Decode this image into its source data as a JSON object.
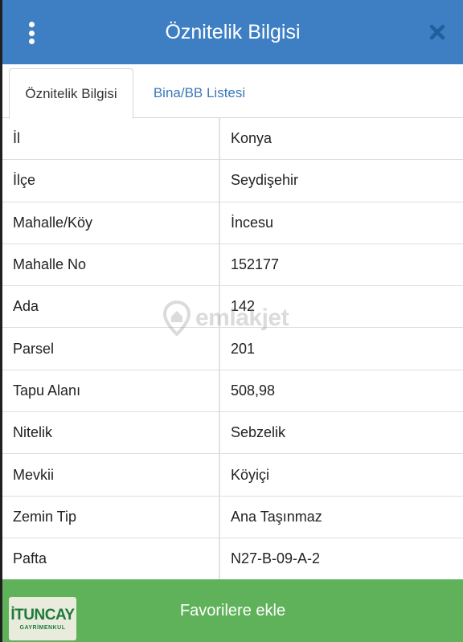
{
  "header": {
    "title": "Öznitelik Bilgisi",
    "menu_icon": "vertical-ellipsis-icon",
    "close_icon": "close-icon"
  },
  "tabs": [
    {
      "label": "Öznitelik Bilgisi",
      "active": true
    },
    {
      "label": "Bina/BB Listesi",
      "active": false
    }
  ],
  "attributes": [
    {
      "label": "İl",
      "value": "Konya"
    },
    {
      "label": "İlçe",
      "value": "Seydişehir"
    },
    {
      "label": "Mahalle/Köy",
      "value": "İncesu"
    },
    {
      "label": "Mahalle No",
      "value": "152177"
    },
    {
      "label": "Ada",
      "value": "142"
    },
    {
      "label": "Parsel",
      "value": "201"
    },
    {
      "label": "Tapu Alanı",
      "value": "508,98"
    },
    {
      "label": "Nitelik",
      "value": "Sebzelik"
    },
    {
      "label": "Mevkii",
      "value": "Köyiçi"
    },
    {
      "label": "Zemin Tip",
      "value": "Ana Taşınmaz"
    },
    {
      "label": "Pafta",
      "value": "N27-B-09-A-2"
    }
  ],
  "watermark": {
    "text": "emlakjet"
  },
  "footer": {
    "button_label": "Favorilere ekle"
  },
  "logo": {
    "main": "İTUNCAY",
    "sub": "GAYRİMENKUL"
  },
  "colors": {
    "header_bg": "#3e7fc4",
    "tab_link": "#3a78b8",
    "footer_bg": "#5fb25a",
    "logo_green": "#1f7a3a"
  }
}
